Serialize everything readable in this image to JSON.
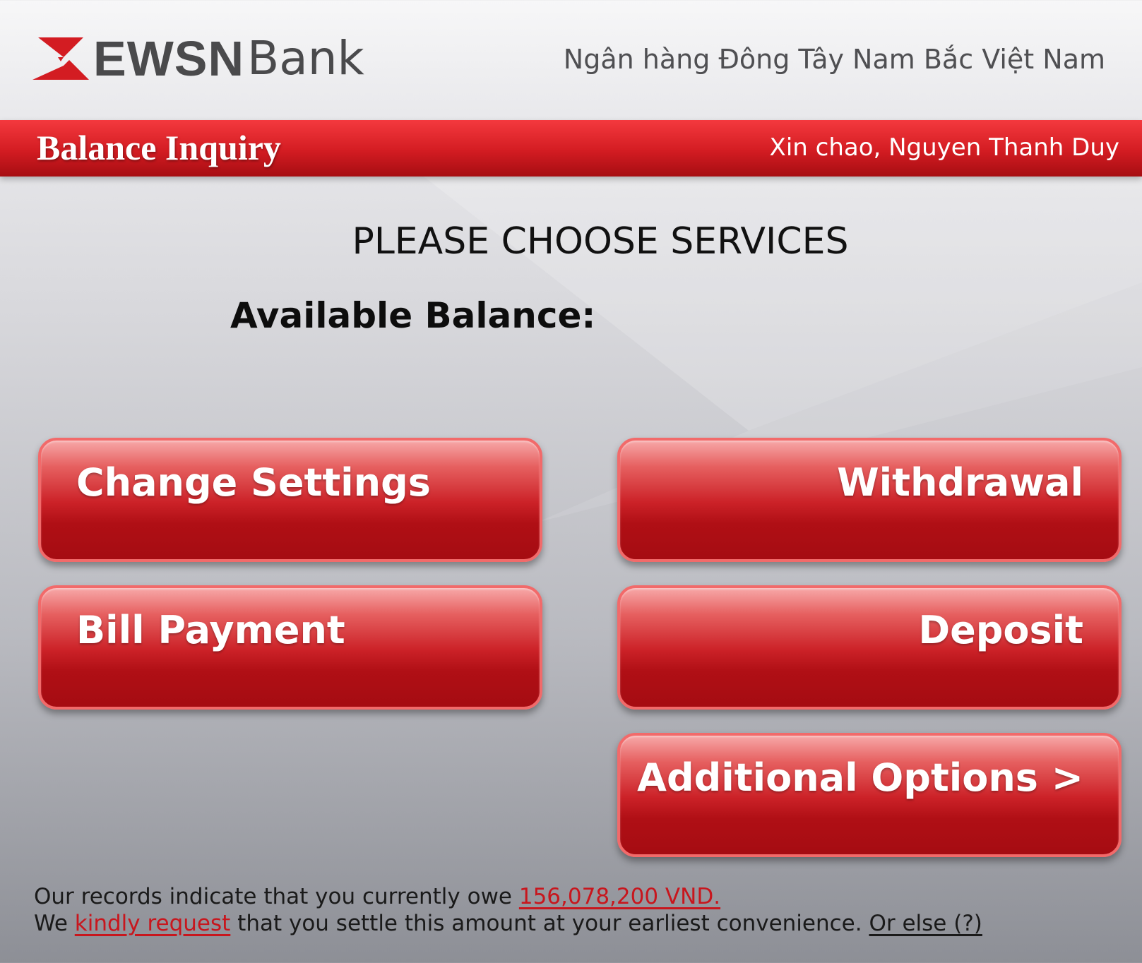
{
  "header": {
    "logo_bold": "EWSN",
    "logo_light": "Bank",
    "tagline": "Ngân hàng Đông Tây Nam Bắc Việt Nam"
  },
  "title_bar": {
    "title": "Balance Inquiry",
    "greeting": "Xin chao, Nguyen Thanh Duy"
  },
  "main": {
    "heading": "PLEASE CHOOSE SERVICES",
    "balance_label": "Available Balance:"
  },
  "buttons": {
    "change_settings": "Change Settings",
    "bill_payment": "Bill Payment",
    "withdrawal": "Withdrawal",
    "deposit": "Deposit",
    "additional_options": "Additional Options >"
  },
  "notice": {
    "line1_prefix": "Our records indicate that you currently owe ",
    "amount": "156,078,200 VND.",
    "line2_prefix": "We ",
    "kindly_request": "kindly request",
    "line2_middle": " that you settle this amount at your earliest convenience. ",
    "or_else": "Or else (?)"
  },
  "colors": {
    "brand_red": "#d31c22",
    "button_red": "#b00f15",
    "link_red": "#c8161d",
    "logo_gray": "#4a4a4c"
  }
}
